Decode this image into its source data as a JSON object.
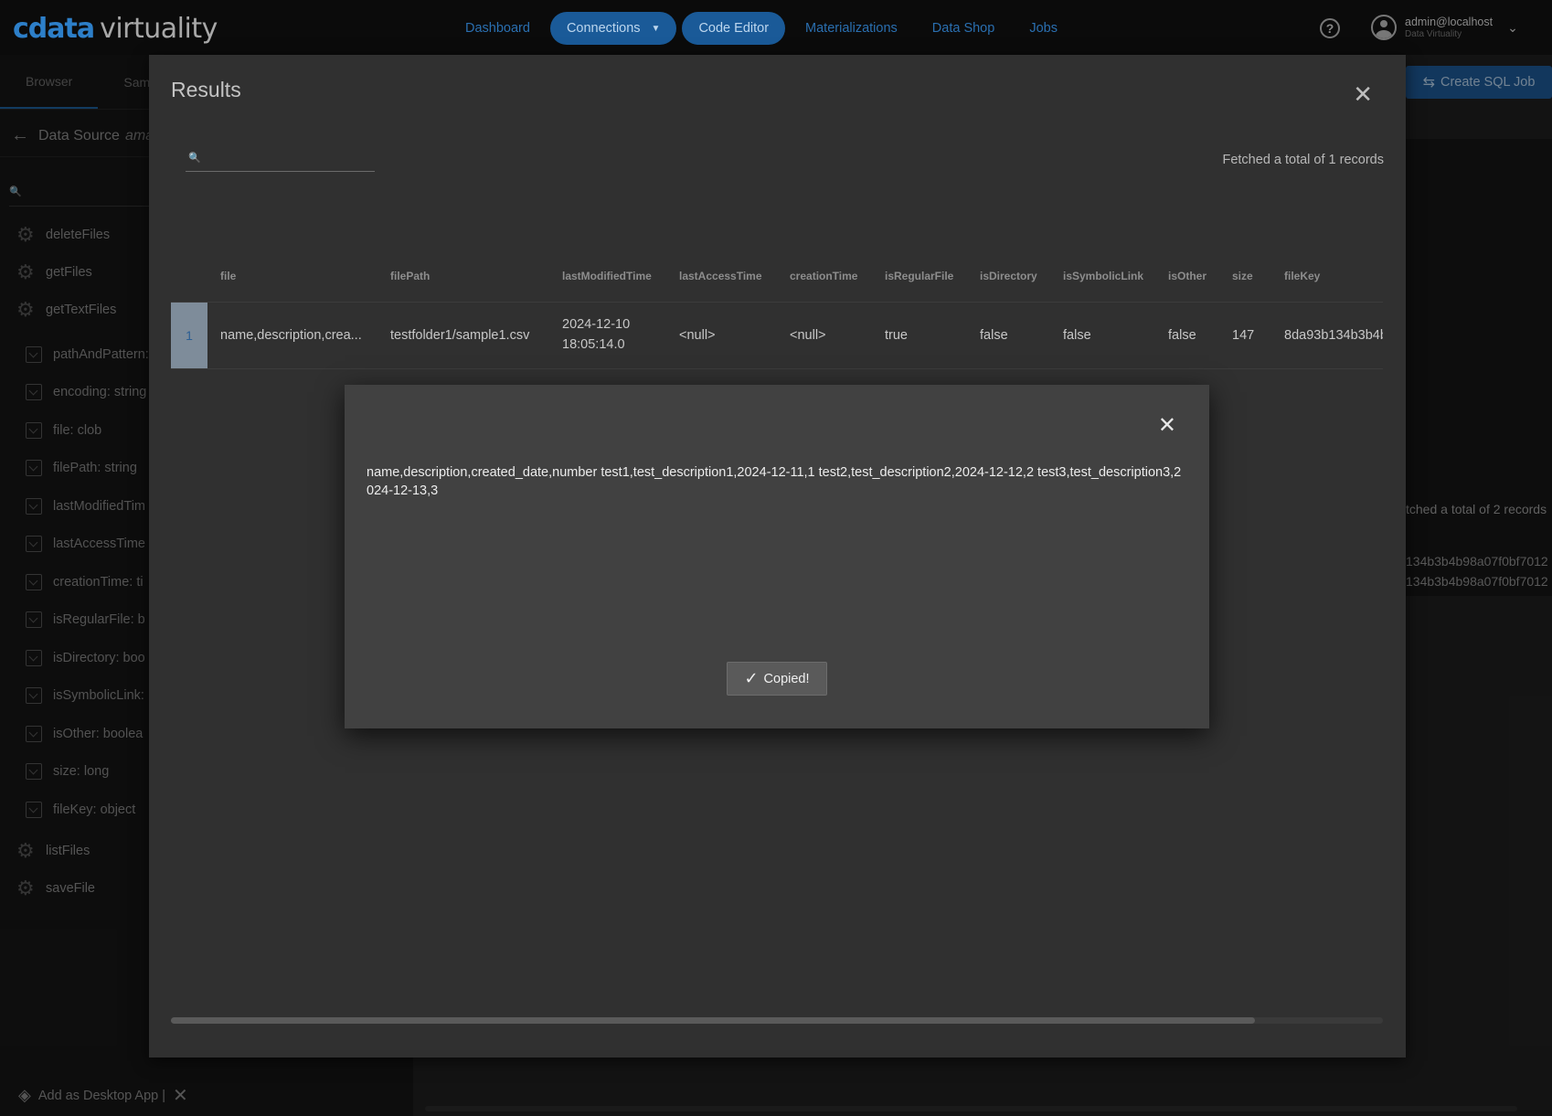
{
  "app": {
    "brand": "cdata",
    "product": "virtuality"
  },
  "nav": {
    "items": [
      {
        "label": "Dashboard"
      },
      {
        "label": "Connections"
      },
      {
        "label": "Code Editor"
      },
      {
        "label": "Materializations"
      },
      {
        "label": "Data Shop"
      },
      {
        "label": "Jobs"
      }
    ],
    "help_icon": "?",
    "user": {
      "name": "admin@localhost",
      "org": "Data Virtuality"
    }
  },
  "sidebar": {
    "tabs": [
      {
        "label": "Browser"
      },
      {
        "label": "Sam"
      }
    ],
    "data_source_label": "Data Source",
    "data_source_name": "ama",
    "procedures_top": [
      {
        "label": "deleteFiles"
      },
      {
        "label": "getFiles"
      },
      {
        "label": "getTextFiles"
      }
    ],
    "params": [
      {
        "label": "pathAndPattern:"
      },
      {
        "label": "encoding:  string"
      },
      {
        "label": "file:  clob"
      },
      {
        "label": "filePath:  string"
      },
      {
        "label": "lastModifiedTim"
      },
      {
        "label": "lastAccessTime"
      },
      {
        "label": "creationTime:  ti"
      },
      {
        "label": "isRegularFile:  b"
      },
      {
        "label": "isDirectory:  boo"
      },
      {
        "label": "isSymbolicLink:"
      },
      {
        "label": "isOther:  boolea"
      },
      {
        "label": "size:  long"
      },
      {
        "label": "fileKey:  object"
      }
    ],
    "procedures_bottom": [
      {
        "label": "listFiles"
      },
      {
        "label": "saveFile"
      }
    ],
    "add_desktop": "Add as Desktop App |"
  },
  "background": {
    "create_job": "Create SQL Job",
    "fetched": "tched a total of 2 records",
    "keys": [
      "134b3b4b98a07f0bf7012",
      "134b3b4b98a07f0bf7012"
    ]
  },
  "results": {
    "title": "Results",
    "search_placeholder": "",
    "fetched": "Fetched a total of 1 records",
    "columns": [
      "",
      "file",
      "filePath",
      "lastModifiedTime",
      "lastAccessTime",
      "creationTime",
      "isRegularFile",
      "isDirectory",
      "isSymbolicLink",
      "isOther",
      "size",
      "fileKey"
    ],
    "rows": [
      {
        "rownum": "1",
        "file": "name,description,crea...",
        "filePath": "testfolder1/sample1.csv",
        "lastModifiedTime_date": "2024-12-10",
        "lastModifiedTime_time": "18:05:14.0",
        "lastAccessTime": "<null>",
        "creationTime": "<null>",
        "isRegularFile": "true",
        "isDirectory": "false",
        "isSymbolicLink": "false",
        "isOther": "false",
        "size": "147",
        "fileKey": "8da93b134b3b4b"
      }
    ]
  },
  "popup": {
    "content": "name,description,created_date,number test1,test_description1,2024-12-11,1 test2,test_description2,2024-12-12,2 test3,test_description3,2024-12-13,3",
    "copied_label": "Copied!"
  }
}
